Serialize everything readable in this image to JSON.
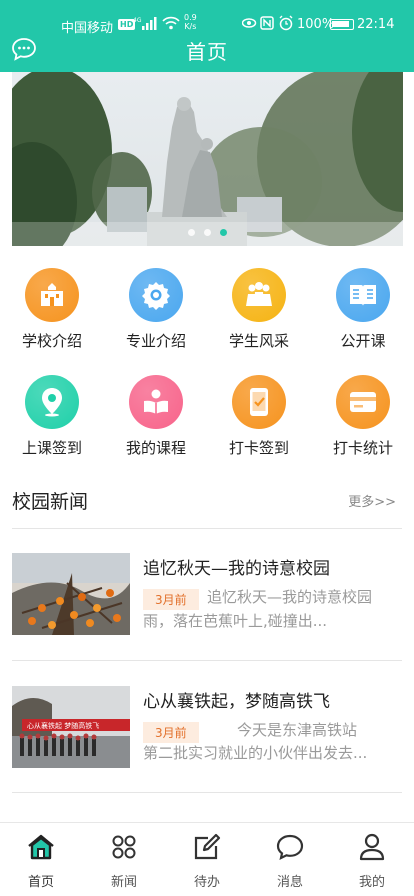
{
  "status_bar": {
    "carrier": "中国移动",
    "hd": "HD",
    "speed_value": "0.9",
    "speed_unit": "K/s",
    "battery": "100%",
    "time": "22:14"
  },
  "header": {
    "title": "首页"
  },
  "banner": {
    "slide_count": 3,
    "active_index": 2
  },
  "grid": [
    {
      "label": "学校介绍",
      "icon": "school-icon",
      "color": "#f6931e"
    },
    {
      "label": "专业介绍",
      "icon": "badge-icon",
      "color": "#4aa7ef"
    },
    {
      "label": "学生风采",
      "icon": "students-icon",
      "color": "#f6b312"
    },
    {
      "label": "公开课",
      "icon": "book-icon",
      "color": "#4aa7ef"
    },
    {
      "label": "上课签到",
      "icon": "location-icon",
      "color": "#1fd0a9"
    },
    {
      "label": "我的课程",
      "icon": "reading-icon",
      "color": "#f7638a"
    },
    {
      "label": "打卡签到",
      "icon": "phone-check-icon",
      "color": "#f6931e"
    },
    {
      "label": "打卡统计",
      "icon": "card-icon",
      "color": "#f6931e"
    }
  ],
  "news_section": {
    "title": "校园新闻",
    "more": "更多>>"
  },
  "news": [
    {
      "title": "追忆秋天—我的诗意校园",
      "time": "3月前",
      "summary": "追忆秋天—我的诗意校园　雨，落在芭蕉叶上,碰撞出..."
    },
    {
      "title": "心从襄铁起，梦随高铁飞",
      "time": "3月前",
      "summary": "今天是东津高铁站",
      "summary2": "第二批实习就业的小伙伴出发去..."
    }
  ],
  "tabbar": [
    {
      "label": "首页",
      "icon": "home-icon",
      "active": true
    },
    {
      "label": "新闻",
      "icon": "news-icon",
      "active": false
    },
    {
      "label": "待办",
      "icon": "todo-icon",
      "active": false
    },
    {
      "label": "消息",
      "icon": "message-icon",
      "active": false
    },
    {
      "label": "我的",
      "icon": "profile-icon",
      "active": false
    }
  ],
  "colors": {
    "brand": "#22c7a9",
    "tag_bg": "#fdecdf",
    "tag_text": "#e2702b"
  }
}
